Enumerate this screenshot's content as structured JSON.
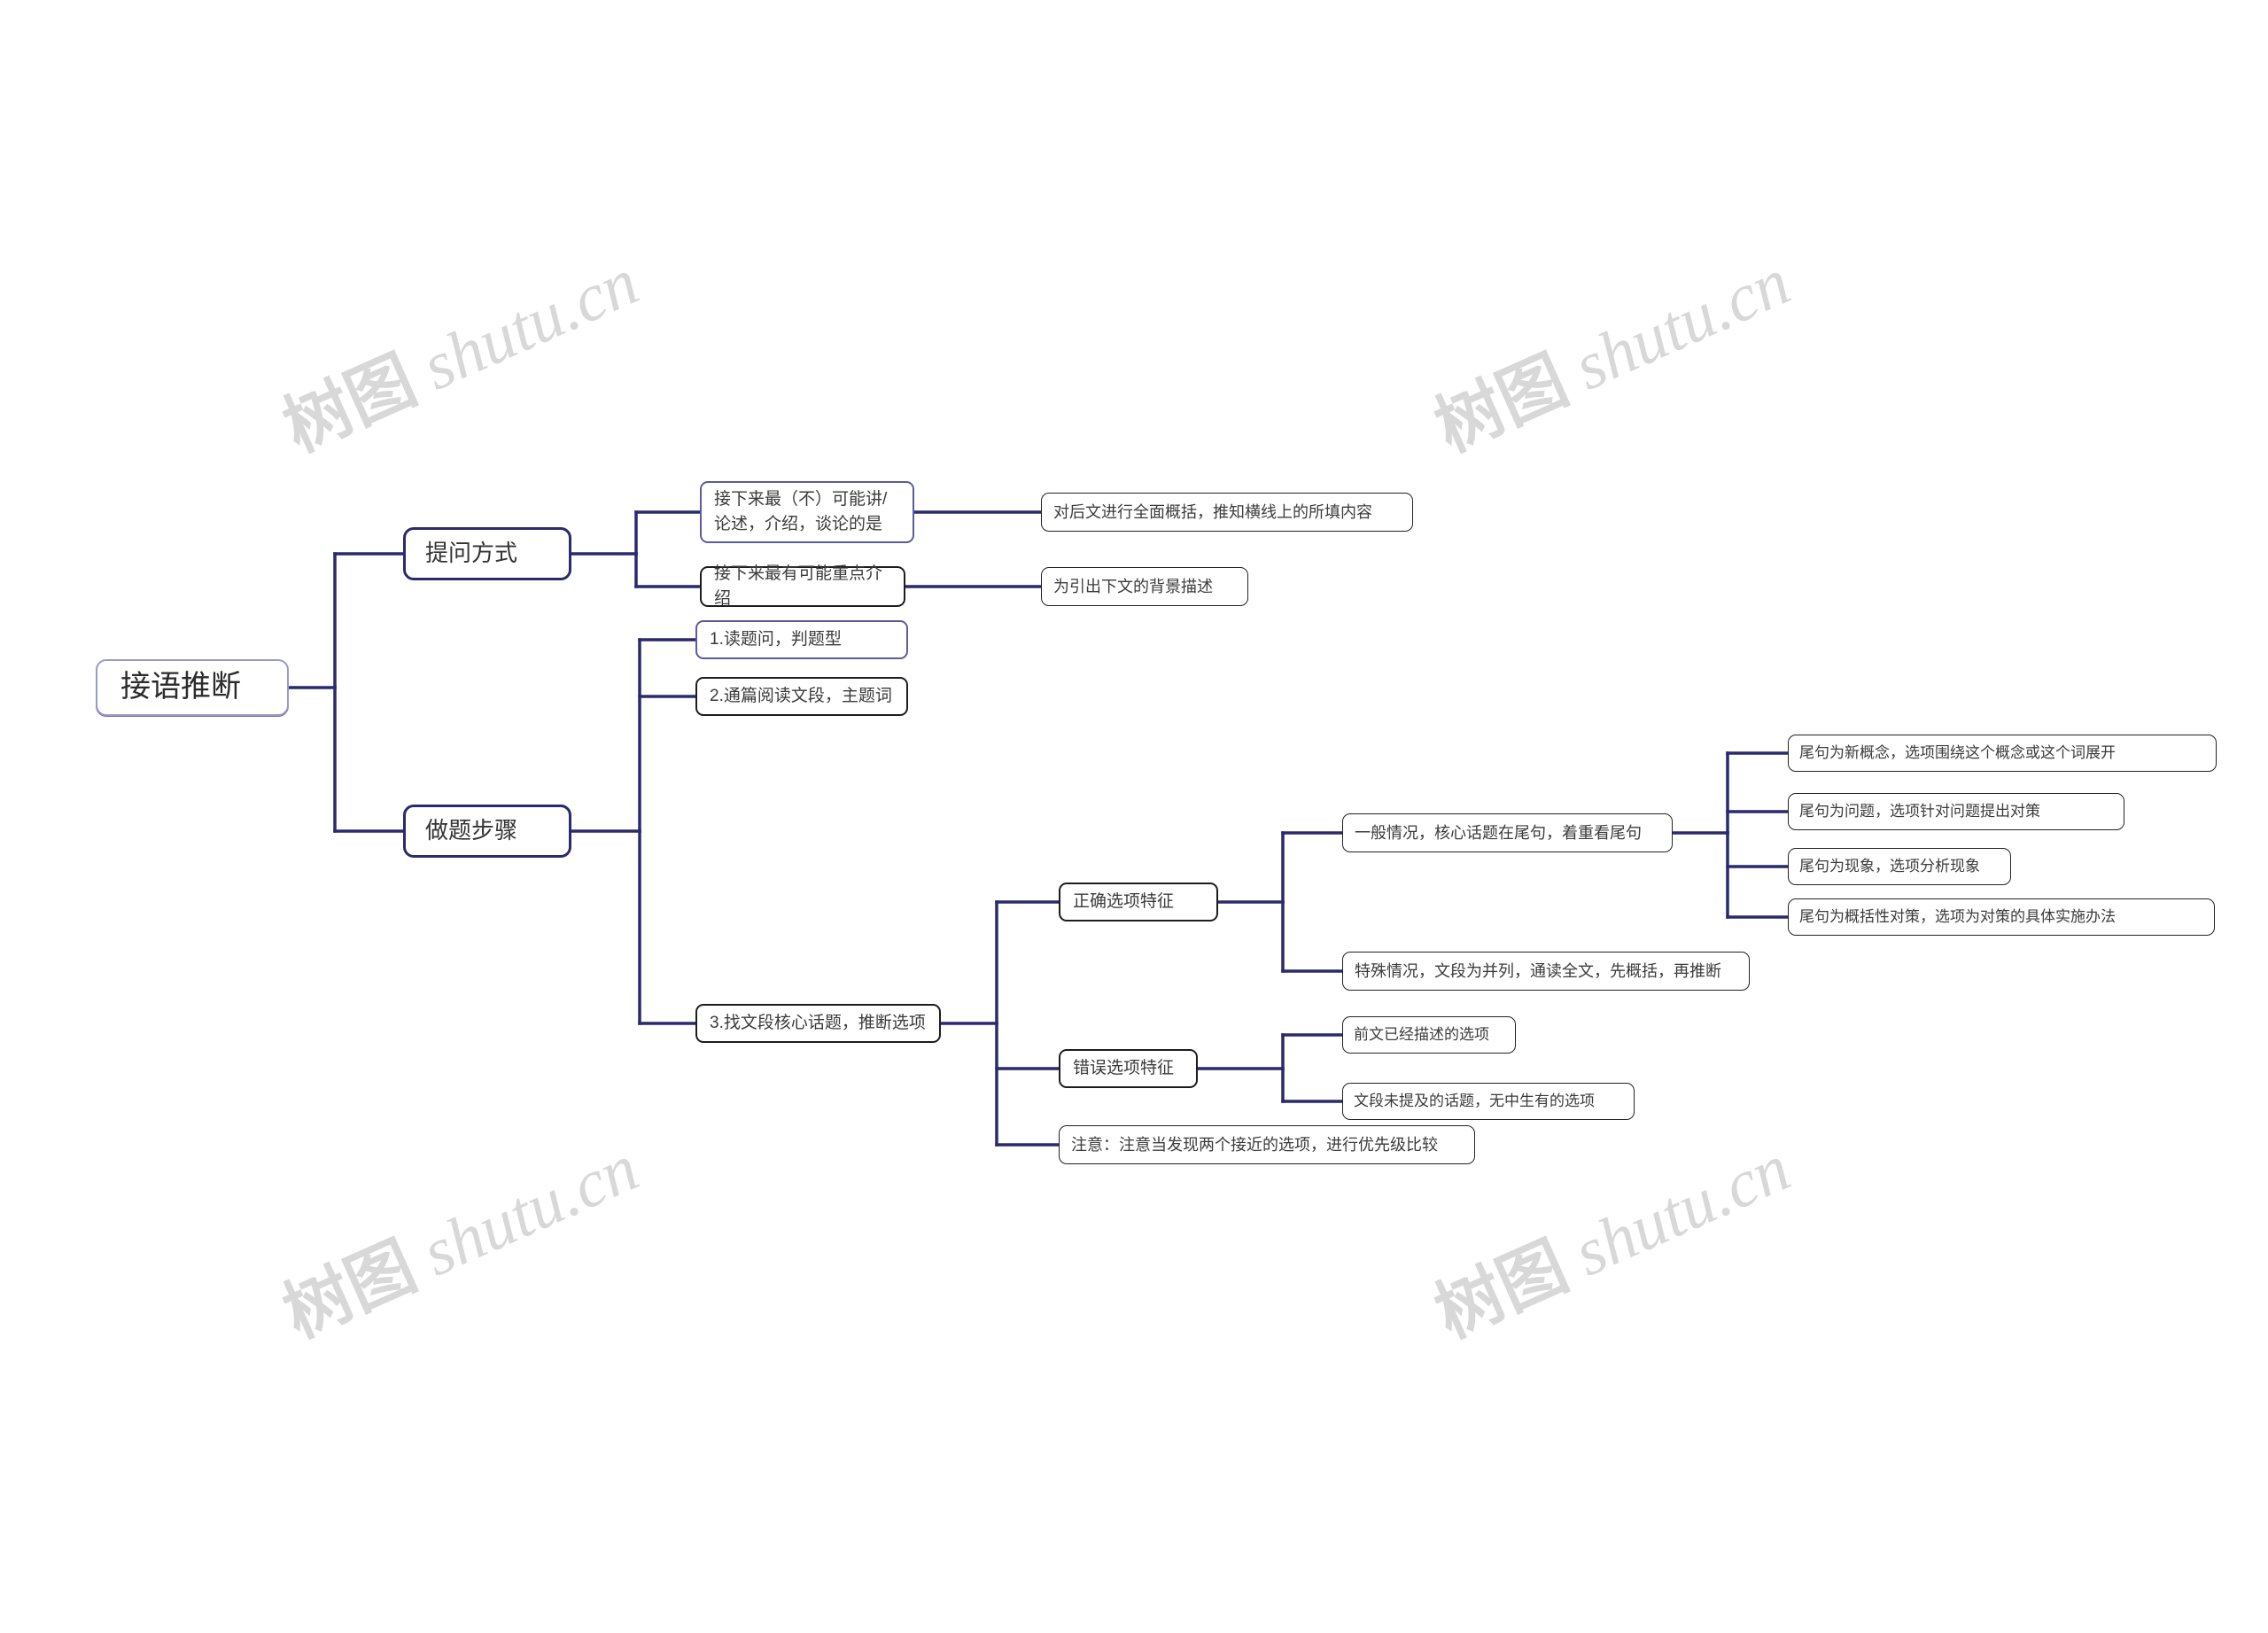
{
  "watermark": {
    "text_cn": "树图",
    "text_en": "shutu.cn",
    "color": "#d8d8d8"
  },
  "theme": {
    "root_border": "#9a9ac8",
    "branch_border": "#2a2a6e",
    "node_border_purple": "#5b5b9e",
    "node_border_dark": "#1d1d1d",
    "link_color": "#2a2a6e",
    "background": "#ffffff",
    "text_color": "#3b3b3b"
  },
  "mindmap": {
    "root": {
      "label": "接语推断"
    },
    "branches": [
      {
        "label": "提问方式",
        "children": [
          {
            "label": "接下来最（不）可能讲/\n论述，介绍，谈论的是",
            "children": [
              {
                "label": "对后文进行全面概括，推知横线上的所填内容"
              }
            ]
          },
          {
            "label": "接下来最有可能重点介绍",
            "children": [
              {
                "label": "为引出下文的背景描述"
              }
            ]
          }
        ]
      },
      {
        "label": "做题步骤",
        "children": [
          {
            "label": "1.读题问，判题型"
          },
          {
            "label": "2.通篇阅读文段，主题词"
          },
          {
            "label": "3.找文段核心话题，推断选项",
            "children": [
              {
                "label": "正确选项特征",
                "children": [
                  {
                    "label": "一般情况，核心话题在尾句，着重看尾句",
                    "children": [
                      {
                        "label": "尾句为新概念，选项围绕这个概念或这个词展开"
                      },
                      {
                        "label": "尾句为问题，选项针对问题提出对策"
                      },
                      {
                        "label": "尾句为现象，选项分析现象"
                      },
                      {
                        "label": "尾句为概括性对策，选项为对策的具体实施办法"
                      }
                    ]
                  },
                  {
                    "label": "特殊情况，文段为并列，通读全文，先概括，再推断"
                  }
                ]
              },
              {
                "label": "错误选项特征",
                "children": [
                  {
                    "label": "前文已经描述的选项"
                  },
                  {
                    "label": "文段未提及的话题，无中生有的选项"
                  }
                ]
              },
              {
                "label": "注意：注意当发现两个接近的选项，进行优先级比较"
              }
            ]
          }
        ]
      }
    ]
  },
  "nodes": {
    "root": "接语推断",
    "b1": "提问方式",
    "b2": "做题步骤",
    "b1c1": "接下来最（不）可能讲/\n论述，介绍，谈论的是",
    "b1c2": "接下来最有可能重点介绍",
    "b1c1l1": "对后文进行全面概括，推知横线上的所填内容",
    "b1c2l1": "为引出下文的背景描述",
    "s1": "1.读题问，判题型",
    "s2": "2.通篇阅读文段，主题词",
    "s3": "3.找文段核心话题，推断选项",
    "right_feat": "正确选项特征",
    "wrong_feat": "错误选项特征",
    "note": "注意：注意当发现两个接近的选项，进行优先级比较",
    "general_case": "一般情况，核心话题在尾句，着重看尾句",
    "special_case": "特殊情况，文段为并列，通读全文，先概括，再推断",
    "tail_concept": "尾句为新概念，选项围绕这个概念或这个词展开",
    "tail_question": "尾句为问题，选项针对问题提出对策",
    "tail_phenomenon": "尾句为现象，选项分析现象",
    "tail_policy": "尾句为概括性对策，选项为对策的具体实施办法",
    "wrong1": "前文已经描述的选项",
    "wrong2": "文段未提及的话题，无中生有的选项"
  }
}
